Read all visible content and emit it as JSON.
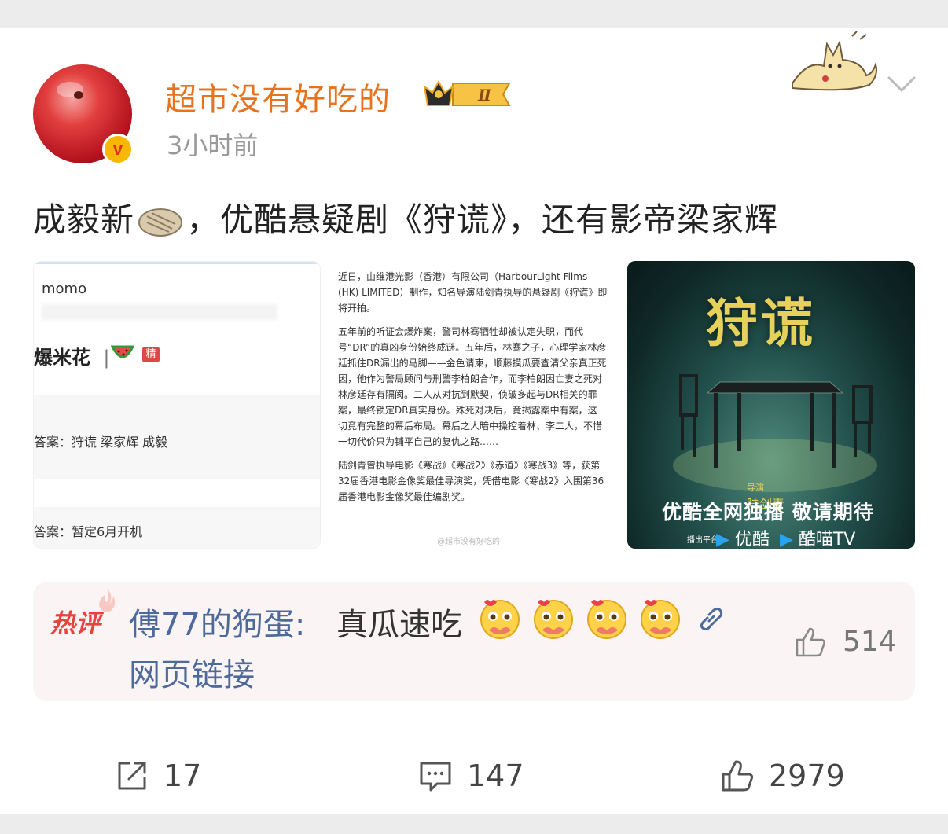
{
  "post": {
    "username": "超市没有好吃的",
    "level_badge": "Ⅱ",
    "verified_mark": "v",
    "timestamp": "3小时前",
    "text_before": "成毅新",
    "text_after": "，优酷悬疑剧《狩谎》，还有影帝梁家辉"
  },
  "images": {
    "img1": {
      "app_name": "momo",
      "popcorn_title": "爆米花",
      "divider": "|",
      "tag": "精",
      "answer1": "答案：狩谎 梁家辉 成毅",
      "answer2": "答案：暂定6月开机"
    },
    "img2": {
      "para1": "近日，由维港光影（香港）有限公司（HarbourLight Films (HK) LIMITED）制作，知名导演陆剑青执导的悬疑剧《狩谎》即将开拍。",
      "para2": "五年前的听证会爆炸案，警司林骞牺牲却被认定失职，而代号“DR”的真凶身份始终成谜。五年后，林骞之子，心理学家林彦廷抓住DR漏出的马脚——金色请柬，顺藤摸瓜要查清父亲真正死因，他作为警局顾问与刑警李柏朗合作，而李柏朗因亡妻之死对林彦廷存有隔阂。二人从对抗到默契，侦破多起与DR相关的罪案，最终锁定DR真实身份。殊死对决后，竟揭露案中有案，这一切竟有完整的幕后布局。幕后之人暗中操控着林、李二人，不惜一切代价只为铺平自己的复仇之路……",
      "para3": "陆剑青曾执导电影《寒战》《寒战2》《赤道》《寒战3》等，获第32届香港电影金像奖最佳导演奖，凭借电影《寒战2》入围第36届香港电影金像奖最佳编剧奖。",
      "watermark": "@超市没有好吃的"
    },
    "img3": {
      "title": "狩谎",
      "director_label": "导演",
      "director": "陆剑青",
      "banner": "优酷全网独播 敬请期待",
      "platform_label": "播出平台",
      "platform1": "优酷",
      "platform2": "酷喵TV"
    }
  },
  "hot_comment": {
    "label": "热评",
    "commenter": "傅77的狗蛋:",
    "text": "真瓜速吃",
    "emoji_name": "pleading-heart-emoji",
    "link_text": "网页链接",
    "likes": "514"
  },
  "actions": {
    "shares": "17",
    "comments": "147",
    "likes": "2979"
  },
  "colors": {
    "username": "#e8731f",
    "commenter": "#4d6a9a",
    "hot_label": "#e8413e",
    "hot_bg": "#fbf4f4",
    "poster_title": "#e6d25a"
  }
}
